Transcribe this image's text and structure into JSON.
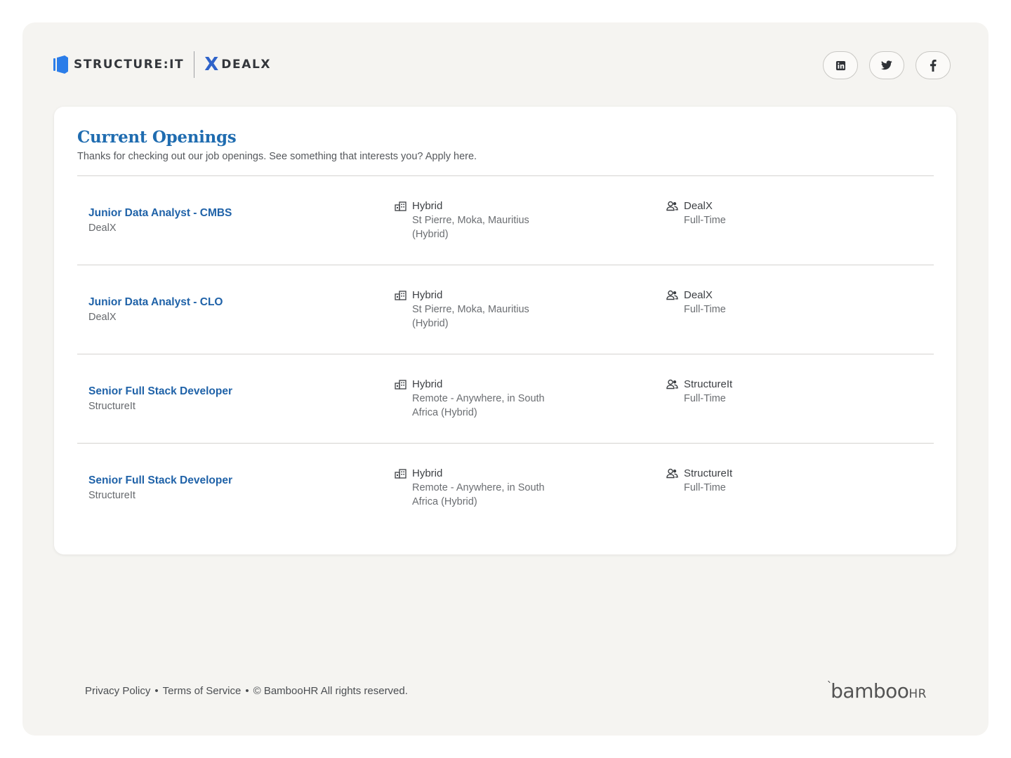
{
  "header": {
    "logo_structureit": "STRUCTURE:IT",
    "logo_dealx": "DEALX",
    "logo_dealx_mark": "X",
    "social": [
      {
        "name": "linkedin-icon"
      },
      {
        "name": "twitter-icon"
      },
      {
        "name": "facebook-icon"
      }
    ]
  },
  "openings": {
    "title": "Current Openings",
    "subtitle": "Thanks for checking out our job openings. See something that interests you? Apply here.",
    "jobs": [
      {
        "title": "Junior Data Analyst - CMBS",
        "department": "DealX",
        "location_type": "Hybrid",
        "location": "St Pierre, Moka, Mauritius (Hybrid)",
        "company": "DealX",
        "employment": "Full-Time"
      },
      {
        "title": "Junior Data Analyst - CLO",
        "department": "DealX",
        "location_type": "Hybrid",
        "location": "St Pierre, Moka, Mauritius (Hybrid)",
        "company": "DealX",
        "employment": "Full-Time"
      },
      {
        "title": "Senior Full Stack Developer",
        "department": "StructureIt",
        "location_type": "Hybrid",
        "location": "Remote - Anywhere, in South Africa (Hybrid)",
        "company": "StructureIt",
        "employment": "Full-Time"
      },
      {
        "title": "Senior Full Stack Developer",
        "department": "StructureIt",
        "location_type": "Hybrid",
        "location": "Remote - Anywhere, in South Africa (Hybrid)",
        "company": "StructureIt",
        "employment": "Full-Time"
      }
    ]
  },
  "footer": {
    "privacy": "Privacy Policy",
    "separator": "•",
    "terms": "Terms of Service",
    "copyright_symbol": "©",
    "copyright": "BambooHR All rights reserved.",
    "brand_main": "bamboo",
    "brand_suffix": "HR",
    "brand_mark": "ˋ"
  },
  "colors": {
    "accent": "#1f6cb0",
    "link": "#1f62a8",
    "logo_blue": "#2b7de9",
    "background": "#f5f4f1"
  }
}
